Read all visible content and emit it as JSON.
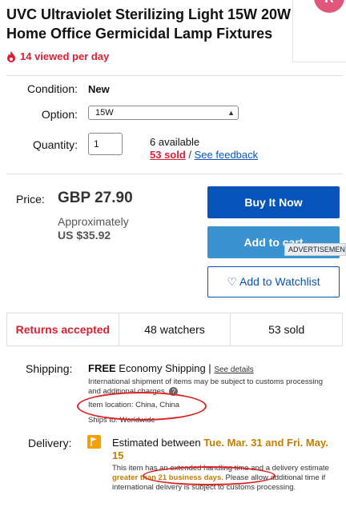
{
  "header": {
    "title_line1": "UVC Ultraviolet Sterilizing Light 15W 20W",
    "title_line2": "Home Office Germicidal Lamp Fixtures",
    "views": "14 viewed per day",
    "avatar_letter": "R"
  },
  "details": {
    "condition_label": "Condition:",
    "condition_value": "New",
    "option_label": "Option:",
    "option_selected": "15W",
    "quantity_label": "Quantity:",
    "quantity_value": "1",
    "available": "6 available",
    "sold_link": "53 sold",
    "separator": " / ",
    "feedback_link": "See feedback"
  },
  "price": {
    "label": "Price:",
    "value": "GBP 27.90",
    "approx_label": "Approximately",
    "usd": "US $35.92"
  },
  "buttons": {
    "buy_now": "Buy It Now",
    "add_to_cart": "Add to cart",
    "watchlist": "Add to Watchlist",
    "advertisement": "ADVERTISEMENT"
  },
  "stats": {
    "returns": "Returns accepted",
    "watchers": "48 watchers",
    "sold": "53 sold"
  },
  "shipping": {
    "label": "Shipping:",
    "free": "FREE",
    "method": "Economy Shipping |",
    "see_details": "See details",
    "note": "International shipment of items may be subject to customs processing and additional charges.",
    "location": "Item location:  China, China",
    "ships_to": "Ships to:  Worldwide"
  },
  "delivery": {
    "label": "Delivery:",
    "estimated": "Estimated between",
    "date_from": "Tue. Mar. 31",
    "and": "and",
    "date_to": "Fri. May. 15",
    "note_part1": "This item has an extended handling time and a delivery estimate",
    "note_highlight": "greater than 21 business days.",
    "note_part2": "Please allow additional time if international delivery is subject to customs processing."
  },
  "colors": {
    "ebay_blue": "#0654ba",
    "cart_blue": "#3a92d1",
    "alert_red": "#dd1e31",
    "delivery_orange": "#c47d00",
    "annotation_red": "#dd2222"
  }
}
